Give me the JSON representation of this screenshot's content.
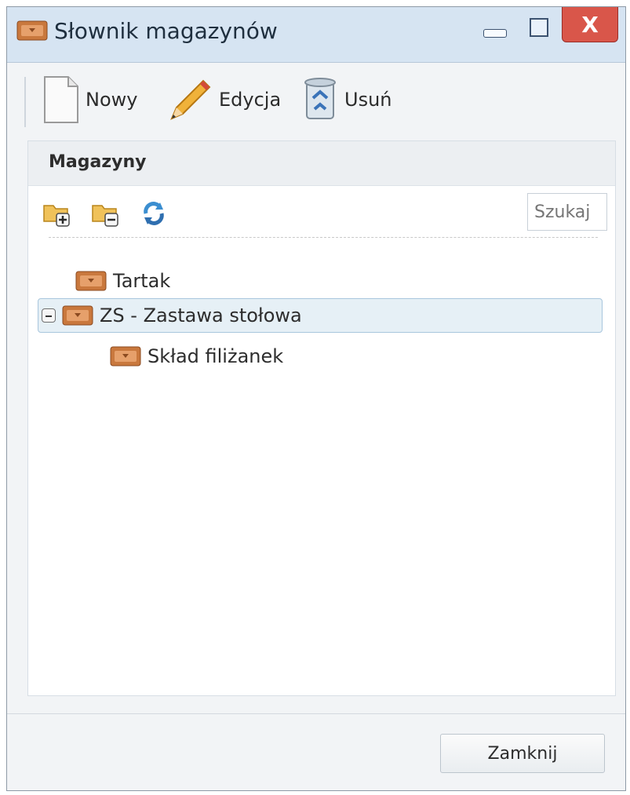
{
  "window": {
    "title": "Słownik magazynów",
    "controls": {
      "close_glyph": "X"
    }
  },
  "toolbar": {
    "new_label": "Nowy",
    "edit_label": "Edycja",
    "delete_label": "Usuń"
  },
  "panel": {
    "title": "Magazyny",
    "search": {
      "placeholder": "Szukaj"
    },
    "tools": [
      "add-folder-icon",
      "remove-folder-icon",
      "refresh-icon"
    ]
  },
  "tree": {
    "items": [
      {
        "label": "Tartak",
        "level": 0
      },
      {
        "label": "ZS - Zastawa stołowa",
        "level": 0,
        "expanded": true,
        "selected": true
      },
      {
        "label": "Skład filiżanek",
        "level": 1
      }
    ]
  },
  "footer": {
    "close_label": "Zamknij"
  },
  "colors": {
    "titlebar": "#d6e4f2",
    "close": "#d9564a",
    "selection": "#e6f0f6"
  }
}
